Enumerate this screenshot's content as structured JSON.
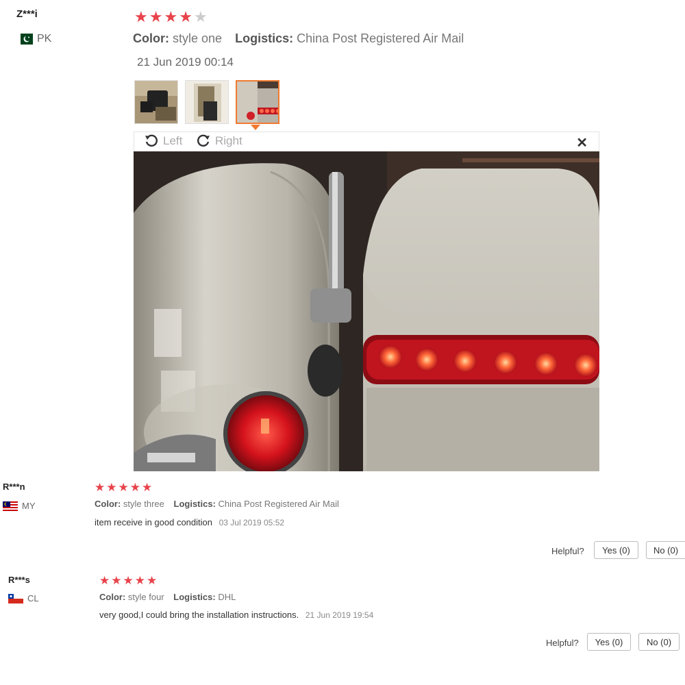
{
  "colors": {
    "star": "#e8434b",
    "star_off": "#cccccc",
    "active_thumb": "#f07a30"
  },
  "reviews": [
    {
      "user": "Z***i",
      "country": "PK",
      "flag_icon": "pakistan-flag-icon",
      "rating": 4,
      "color_label": "Color:",
      "color_value": "style one",
      "logistics_label": "Logistics:",
      "logistics_value": "China Post Registered Air Mail",
      "date": "21 Jun 2019 00:14"
    },
    {
      "user": "R***n",
      "country": "MY",
      "flag_icon": "malaysia-flag-icon",
      "rating": 5,
      "color_label": "Color:",
      "color_value": "style three",
      "logistics_label": "Logistics:",
      "logistics_value": "China Post Registered Air Mail",
      "text": "item receive in good condition",
      "date": "03 Jul 2019 05:52",
      "helpful_label": "Helpful?",
      "yes_label": "Yes (0)",
      "no_label": "No (0)"
    },
    {
      "user": "R***s",
      "country": "CL",
      "flag_icon": "chile-flag-icon",
      "rating": 5,
      "color_label": "Color:",
      "color_value": "style four",
      "logistics_label": "Logistics:",
      "logistics_value": "DHL",
      "text": "very good,I could bring the installation instructions.",
      "date": "21 Jun 2019 19:54",
      "helpful_label": "Helpful?",
      "yes_label": "Yes (0)",
      "no_label": "No (0)"
    }
  ],
  "viewer": {
    "rotate_left_label": "Left",
    "rotate_right_label": "Right",
    "close_icon": "close-icon",
    "selected_thumbnail": 3
  }
}
